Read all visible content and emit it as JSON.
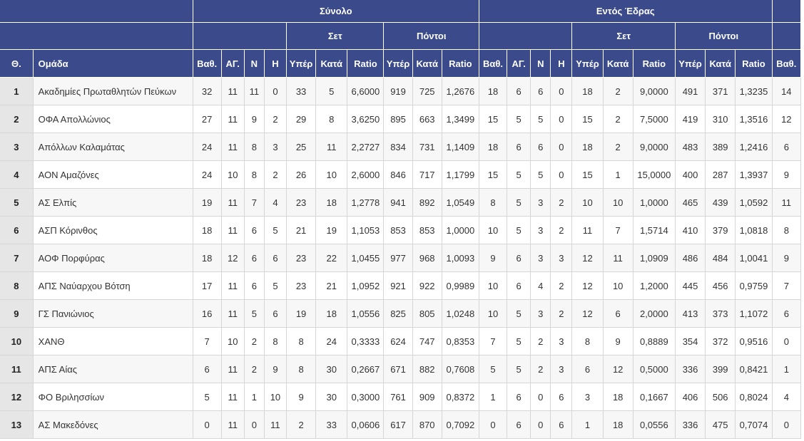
{
  "header": {
    "total_label": "Σύνολο",
    "home_label": "Εντός Έδρας",
    "sets_label": "Σετ",
    "points_label": "Πόντοι",
    "cols": [
      "Θ.",
      "Ομάδα",
      "Βαθ.",
      "ΑΓ.",
      "Ν",
      "Η",
      "Υπέρ",
      "Κατά",
      "Ratio",
      "Υπέρ",
      "Κατά",
      "Ratio",
      "Βαθ.",
      "ΑΓ.",
      "Ν",
      "Η",
      "Υπέρ",
      "Κατά",
      "Ratio",
      "Υπέρ",
      "Κατά",
      "Ratio",
      "Βαθ."
    ]
  },
  "rows": [
    [
      "1",
      "Ακαδημίες Πρωταθλητών Πεύκων",
      "32",
      "11",
      "11",
      "0",
      "33",
      "5",
      "6,6000",
      "919",
      "725",
      "1,2676",
      "18",
      "6",
      "6",
      "0",
      "18",
      "2",
      "9,0000",
      "491",
      "371",
      "1,3235",
      "14"
    ],
    [
      "2",
      "ΟΦΑ Απολλώνιος",
      "27",
      "11",
      "9",
      "2",
      "29",
      "8",
      "3,6250",
      "895",
      "663",
      "1,3499",
      "15",
      "5",
      "5",
      "0",
      "15",
      "2",
      "7,5000",
      "419",
      "310",
      "1,3516",
      "12"
    ],
    [
      "3",
      "Απόλλων Καλαμάτας",
      "24",
      "11",
      "8",
      "3",
      "25",
      "11",
      "2,2727",
      "834",
      "731",
      "1,1409",
      "18",
      "6",
      "6",
      "0",
      "18",
      "2",
      "9,0000",
      "483",
      "389",
      "1,2416",
      "6"
    ],
    [
      "4",
      "ΑΟΝ Αμαζόνες",
      "24",
      "10",
      "8",
      "2",
      "26",
      "10",
      "2,6000",
      "846",
      "717",
      "1,1799",
      "15",
      "5",
      "5",
      "0",
      "15",
      "1",
      "15,0000",
      "400",
      "287",
      "1,3937",
      "9"
    ],
    [
      "5",
      "ΑΣ Ελπίς",
      "19",
      "11",
      "7",
      "4",
      "23",
      "18",
      "1,2778",
      "941",
      "892",
      "1,0549",
      "8",
      "5",
      "3",
      "2",
      "10",
      "10",
      "1,0000",
      "465",
      "439",
      "1,0592",
      "11"
    ],
    [
      "6",
      "ΑΣΠ Κόρινθος",
      "18",
      "11",
      "6",
      "5",
      "21",
      "19",
      "1,1053",
      "853",
      "853",
      "1,0000",
      "10",
      "5",
      "3",
      "2",
      "11",
      "7",
      "1,5714",
      "410",
      "379",
      "1,0818",
      "8"
    ],
    [
      "7",
      "ΑΟΦ Πορφύρας",
      "18",
      "12",
      "6",
      "6",
      "23",
      "22",
      "1,0455",
      "977",
      "968",
      "1,0093",
      "9",
      "6",
      "3",
      "3",
      "12",
      "11",
      "1,0909",
      "486",
      "484",
      "1,0041",
      "9"
    ],
    [
      "8",
      "ΑΠΣ Ναύαρχου Βότση",
      "17",
      "11",
      "6",
      "5",
      "23",
      "21",
      "1,0952",
      "921",
      "922",
      "0,9989",
      "10",
      "6",
      "4",
      "2",
      "12",
      "10",
      "1,2000",
      "445",
      "456",
      "0,9759",
      "7"
    ],
    [
      "9",
      "ΓΣ Πανιώνιος",
      "16",
      "11",
      "5",
      "6",
      "19",
      "18",
      "1,0556",
      "825",
      "805",
      "1,0248",
      "10",
      "5",
      "3",
      "2",
      "12",
      "6",
      "2,0000",
      "413",
      "373",
      "1,1072",
      "6"
    ],
    [
      "10",
      "ΧΑΝΘ",
      "7",
      "10",
      "2",
      "8",
      "8",
      "24",
      "0,3333",
      "624",
      "747",
      "0,8353",
      "7",
      "5",
      "2",
      "3",
      "8",
      "9",
      "0,8889",
      "354",
      "372",
      "0,9516",
      "0"
    ],
    [
      "11",
      "ΑΠΣ Αίας",
      "6",
      "11",
      "2",
      "9",
      "8",
      "30",
      "0,2667",
      "671",
      "882",
      "0,7608",
      "5",
      "5",
      "2",
      "3",
      "6",
      "12",
      "0,5000",
      "336",
      "399",
      "0,8421",
      "1"
    ],
    [
      "12",
      "ΦΟ Βριλησσίων",
      "5",
      "11",
      "1",
      "10",
      "9",
      "30",
      "0,3000",
      "761",
      "909",
      "0,8372",
      "1",
      "6",
      "0",
      "6",
      "3",
      "18",
      "0,1667",
      "406",
      "506",
      "0,8024",
      "4"
    ],
    [
      "13",
      "ΑΣ Μακεδόνες",
      "0",
      "11",
      "0",
      "11",
      "2",
      "33",
      "0,0606",
      "617",
      "870",
      "0,7092",
      "0",
      "6",
      "0",
      "6",
      "1",
      "18",
      "0,0556",
      "336",
      "475",
      "0,7074",
      "0"
    ]
  ]
}
